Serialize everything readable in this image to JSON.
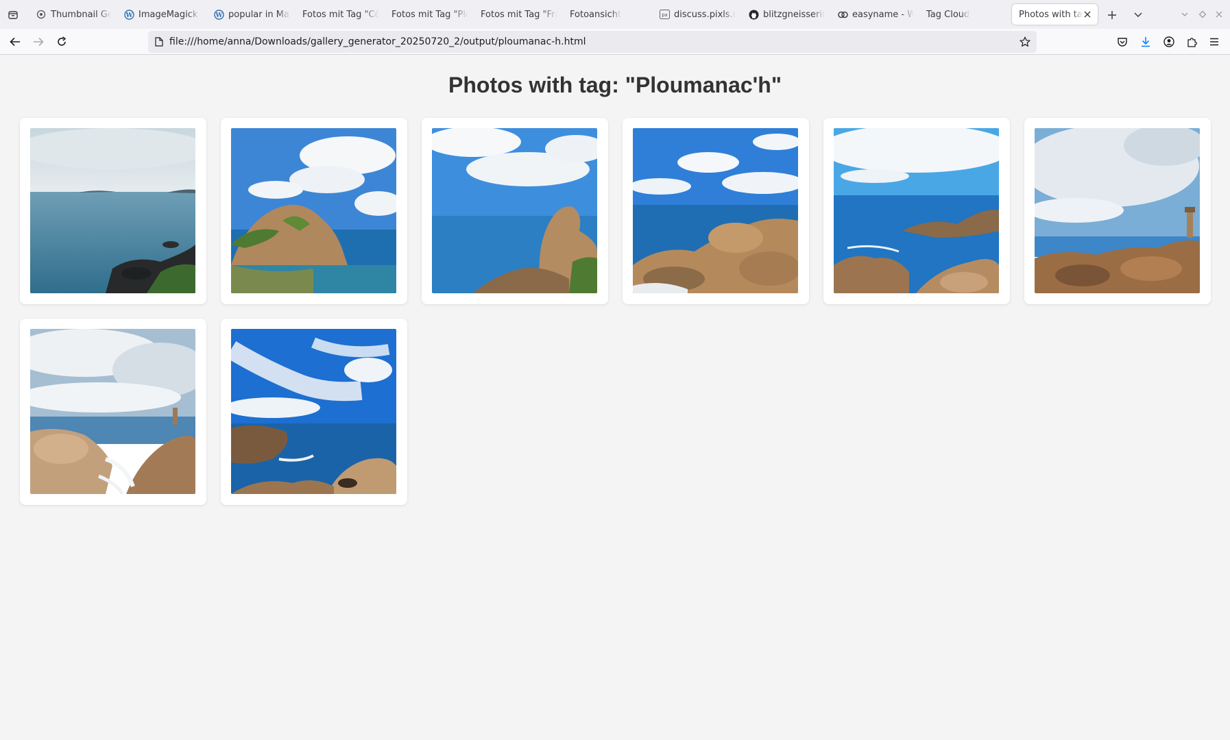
{
  "browser": {
    "tabs": [
      {
        "label": "Thumbnail Gen",
        "icon": "globe-icon"
      },
      {
        "label": "ImageMagick E",
        "icon": "wordpress-icon"
      },
      {
        "label": "popular in May",
        "icon": "wordpress-icon"
      },
      {
        "label": "Fotos mit Tag \"Côte",
        "icon": ""
      },
      {
        "label": "Fotos mit Tag \"Plou",
        "icon": ""
      },
      {
        "label": "Fotos mit Tag \"Fran",
        "icon": ""
      },
      {
        "label": "Fotoansicht",
        "icon": ""
      },
      {
        "label": "discuss.pixls.us",
        "icon": "pixls-icon"
      },
      {
        "label": "blitzgneisserin",
        "icon": "github-icon"
      },
      {
        "label": "easyname - We",
        "icon": "easyname-icon"
      },
      {
        "label": "Tag Cloud",
        "icon": ""
      }
    ],
    "active_tab": {
      "label": "Photos with tag: \"Ploumanac'h\""
    },
    "url": "file:///home/anna/Downloads/gallery_generator_20250720_2/output/ploumanac-h.html"
  },
  "page": {
    "title": "Photos with tag: \"Ploumanac'h\"",
    "photos": [
      {
        "subject": "calm sea bay with distant islands under overcast sky"
      },
      {
        "subject": "rocky outcrop with green vegetation above blue water"
      },
      {
        "subject": "clouds over ocean with stacked granite rocks on the right"
      },
      {
        "subject": "granite boulders in foreground with open sea and clouds"
      },
      {
        "subject": "rocky coastline with waves and bright blue sky"
      },
      {
        "subject": "rocky shore with lighthouse under cloudy sky"
      },
      {
        "subject": "granite rocks and lighthouse with surf under clouds"
      },
      {
        "subject": "rocky coast with surf, deep blue sky and streaky clouds"
      }
    ]
  }
}
